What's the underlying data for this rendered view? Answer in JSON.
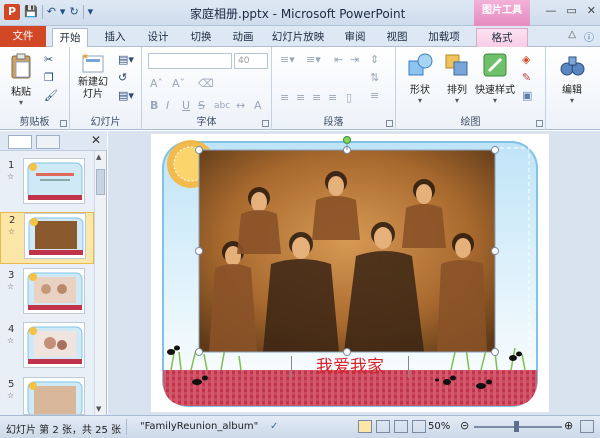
{
  "titlebar": {
    "title": "家庭相册.pptx - Microsoft PowerPoint",
    "context_group": "图片工具",
    "window_buttons": [
      "minimize-icon",
      "restore-icon",
      "close-icon"
    ]
  },
  "tabs": [
    {
      "label": "文件",
      "kind": "file"
    },
    {
      "label": "开始",
      "kind": "active"
    },
    {
      "label": "插入"
    },
    {
      "label": "设计"
    },
    {
      "label": "切换"
    },
    {
      "label": "动画"
    },
    {
      "label": "幻灯片放映"
    },
    {
      "label": "审阅"
    },
    {
      "label": "视图"
    },
    {
      "label": "加载项"
    },
    {
      "label": "格式",
      "kind": "format"
    }
  ],
  "ribbon": {
    "clipboard": {
      "label": "剪贴板",
      "paste": "粘贴"
    },
    "slides": {
      "label": "幻灯片",
      "new_slide": "新建幻灯片"
    },
    "font": {
      "label": "字体",
      "font_size": "40",
      "bold": "B",
      "italic": "I",
      "underline": "U",
      "strike": "S",
      "shadow": "abc"
    },
    "paragraph": {
      "label": "段落"
    },
    "drawing": {
      "label": "绘图",
      "shape": "形状",
      "arrange": "排列",
      "quick_styles": "快速样式"
    },
    "editing": {
      "label": "编辑"
    }
  },
  "thumbnails": [
    {
      "num": "1",
      "selected": false
    },
    {
      "num": "2",
      "selected": true
    },
    {
      "num": "3",
      "selected": false
    },
    {
      "num": "4",
      "selected": false
    },
    {
      "num": "5",
      "selected": false
    }
  ],
  "slide": {
    "caption": "我爱我家"
  },
  "status": {
    "slide_info": "幻灯片 第 2 张，共 25 张",
    "theme": "\"FamilyReunion_album\"",
    "zoom": "50%"
  },
  "colors": {
    "file_tab": "#d24726",
    "caption_red": "#d8232a",
    "frame_blue": "#7fc3e8",
    "ground_red": "#c0334a"
  }
}
